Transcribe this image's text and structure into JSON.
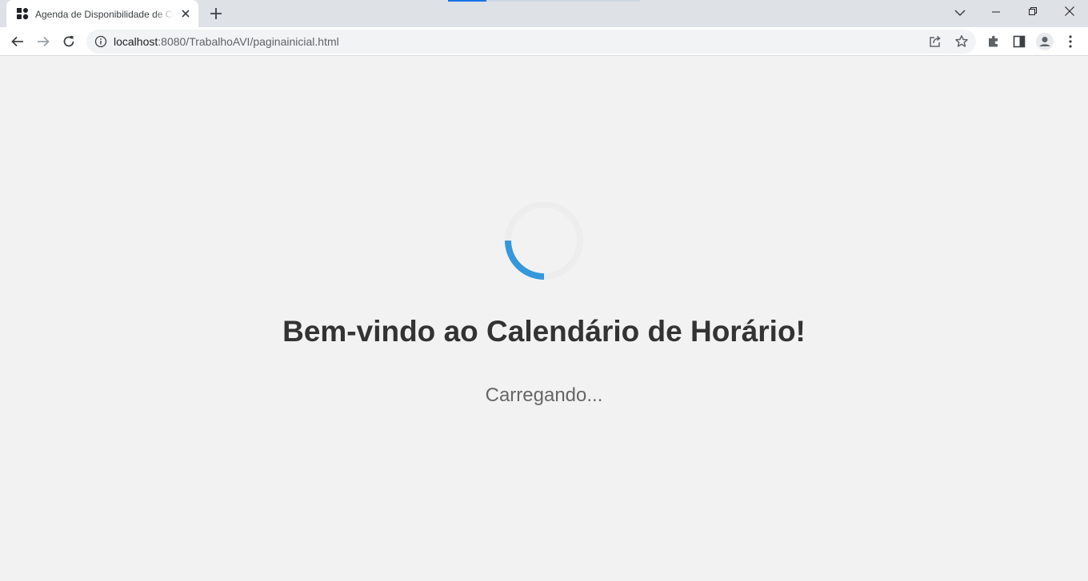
{
  "browser": {
    "tab": {
      "title": "Agenda de Disponibilidade de Consultas",
      "favicon": "app-favicon",
      "close_icon": "close-icon"
    },
    "new_tab_icon": "plus-icon",
    "tab_search_icon": "chevron-down-icon",
    "window_controls": [
      "minimize-icon",
      "restore-icon",
      "close-icon"
    ],
    "toolbar": {
      "back_icon": "arrow-left-icon",
      "forward_icon": "arrow-right-icon",
      "reload_icon": "reload-icon",
      "site_info_icon": "info-icon",
      "url_host": "localhost",
      "url_path": ":8080/TrabalhoAVI/paginainicial.html",
      "share_icon": "share-icon",
      "bookmark_icon": "star-icon",
      "extensions_icon": "puzzle-icon",
      "side_panel_icon": "side-panel-icon",
      "profile_icon": "profile-icon",
      "menu_icon": "kebab-menu-icon"
    },
    "accent_color": "#1a73e8"
  },
  "page": {
    "spinner_color": "#3498db",
    "heading": "Bem-vindo ao Calendário de Horário!",
    "loading_text": "Carregando..."
  }
}
